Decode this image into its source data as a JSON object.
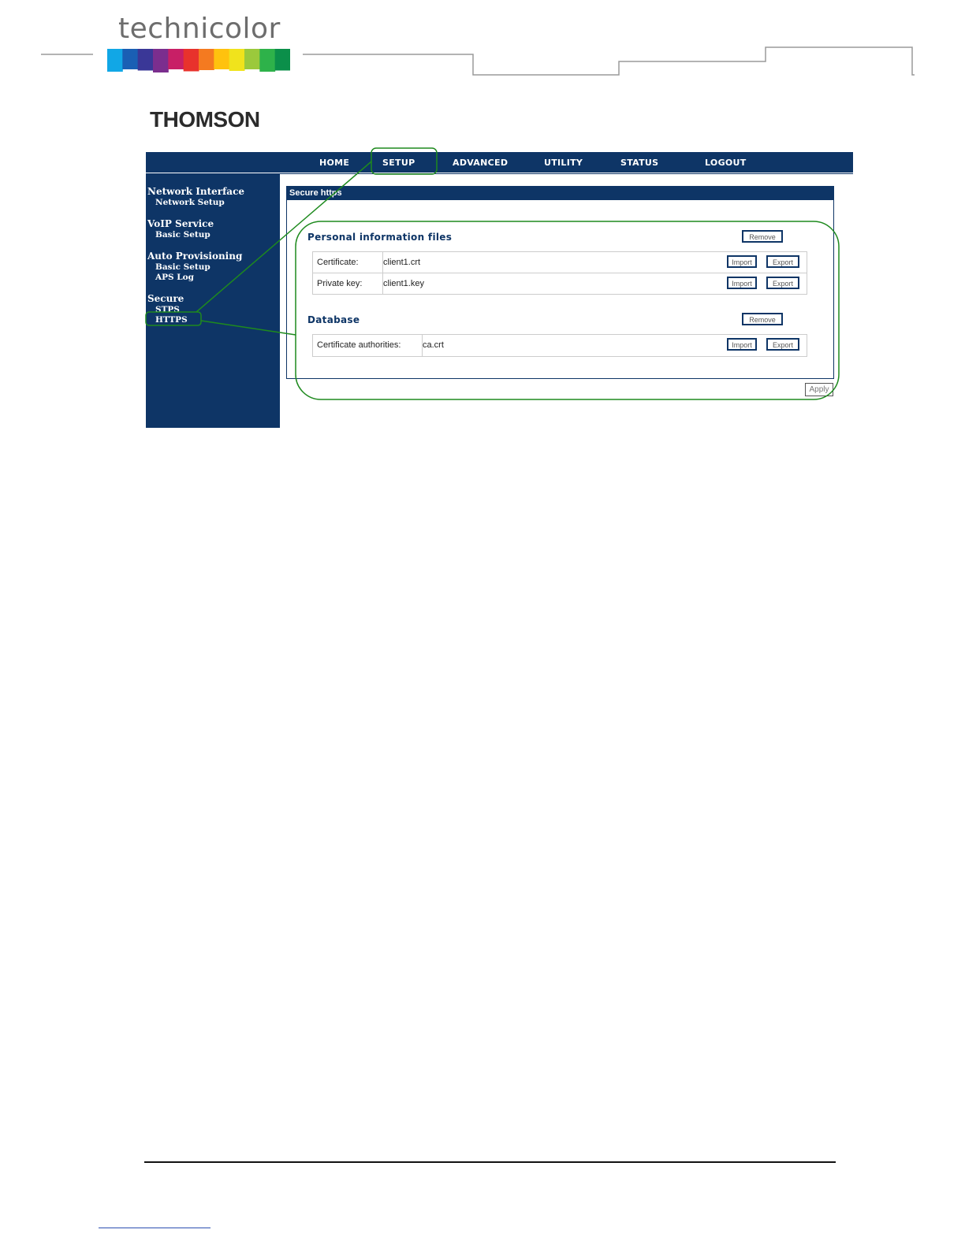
{
  "header": {
    "brand": "technicolor",
    "brand2": "THOMSON",
    "bar_colors": [
      "#11a7e6",
      "#1a5fb4",
      "#3a3797",
      "#7b2e8e",
      "#c81f66",
      "#e8322c",
      "#f47a20",
      "#ffc20e",
      "#f0e31c",
      "#9bc93c",
      "#2eb24a",
      "#0b8f4a"
    ]
  },
  "nav": {
    "items": [
      "HOME",
      "SETUP",
      "ADVANCED",
      "UTILITY",
      "STATUS",
      "LOGOUT"
    ],
    "active": "SETUP"
  },
  "sidebar": {
    "groups": [
      {
        "title": "Network Interface",
        "items": [
          "Network Setup"
        ]
      },
      {
        "title": "VoIP Service",
        "items": [
          "Basic Setup"
        ]
      },
      {
        "title": "Auto Provisioning",
        "items": [
          "Basic Setup",
          "APS Log"
        ]
      },
      {
        "title": "Secure",
        "items": [
          "STPS",
          "HTTPS"
        ]
      }
    ]
  },
  "panel": {
    "title": "Secure https",
    "personal": {
      "title": "Personal information files",
      "remove_label": "Remove",
      "rows": [
        {
          "label": "Certificate:",
          "value": "client1.crt",
          "import": "Import",
          "export": "Export"
        },
        {
          "label": "Private key:",
          "value": "client1.key",
          "import": "Import",
          "export": "Export"
        }
      ]
    },
    "database": {
      "title": "Database",
      "remove_label": "Remove",
      "rows": [
        {
          "label": "Certificate authorities:",
          "value": "ca.crt",
          "import": "Import",
          "export": "Export"
        }
      ]
    },
    "apply_label": "Apply"
  },
  "colors": {
    "nav_bg": "#0e3566",
    "annotation": "#1e8a1e"
  }
}
